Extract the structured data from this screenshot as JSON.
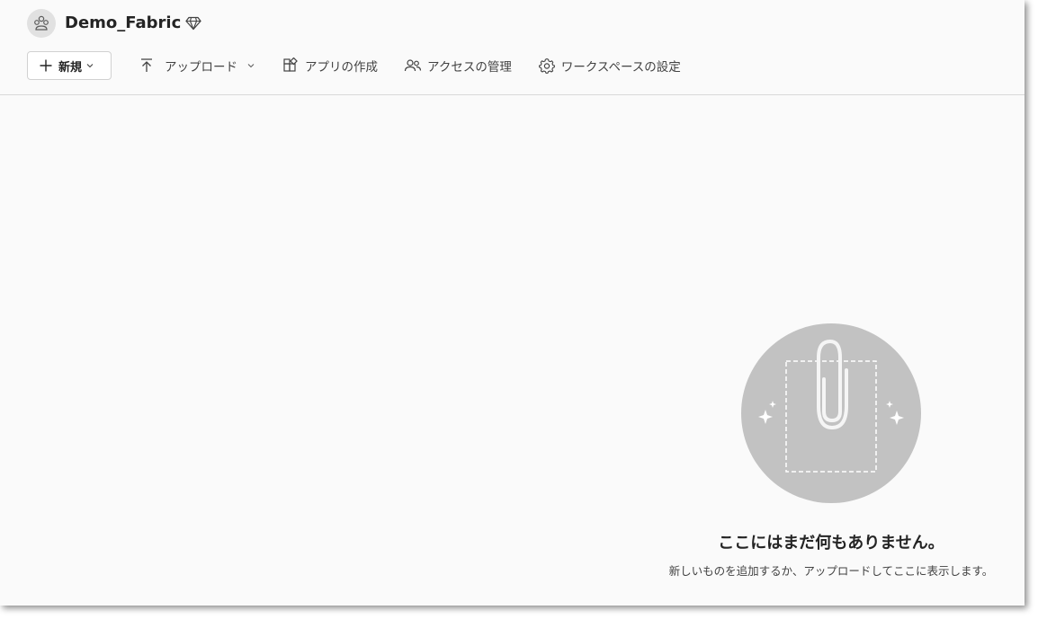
{
  "workspace": {
    "title": "Demo_Fabric",
    "avatar_icon": "workspace-group-icon",
    "premium_icon": "diamond-icon"
  },
  "toolbar": {
    "new_label": "新規",
    "upload_label": "アップロード",
    "create_app_label": "アプリの作成",
    "manage_access_label": "アクセスの管理",
    "workspace_settings_label": "ワークスペースの設定"
  },
  "empty_state": {
    "title": "ここにはまだ何もありません。",
    "subtitle": "新しいものを追加するか、アップロードしてここに表示します。",
    "illustration_icon": "paperclip-icon"
  },
  "colors": {
    "background": "#fafafa",
    "illustration_circle": "#c2c2c2",
    "text_primary": "#242424"
  }
}
